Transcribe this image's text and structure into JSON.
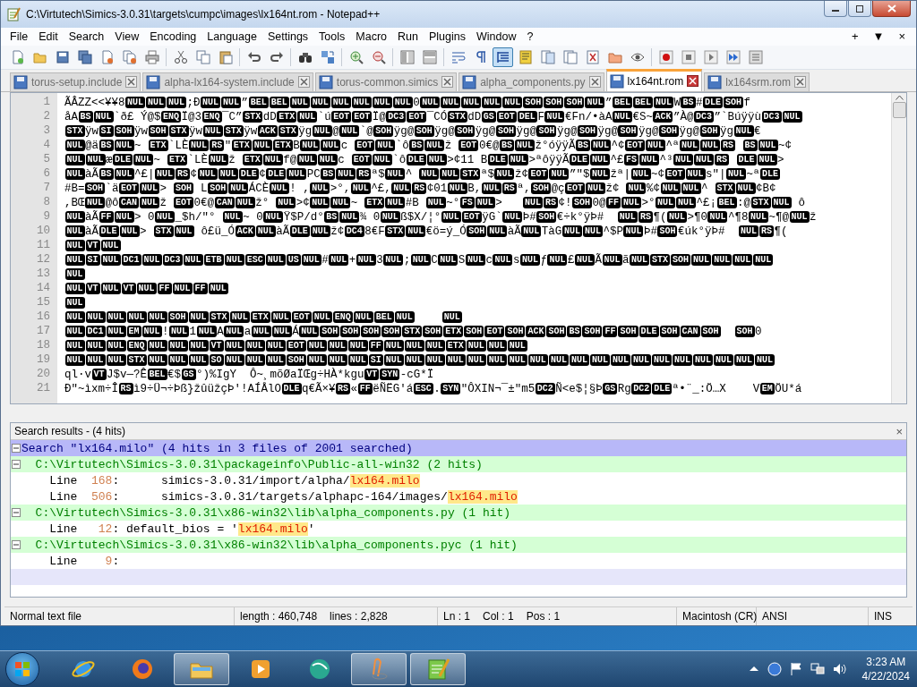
{
  "window": {
    "title": "C:\\Virtutech\\Simics-3.0.31\\targets\\cumpc\\images\\lx164nt.rom - Notepad++"
  },
  "menu": {
    "items": [
      "File",
      "Edit",
      "Search",
      "View",
      "Encoding",
      "Language",
      "Settings",
      "Tools",
      "Macro",
      "Run",
      "Plugins",
      "Window",
      "?"
    ],
    "right": [
      "+",
      "▼",
      "×"
    ]
  },
  "toolbar": [
    {
      "kind": "new",
      "pressed": false
    },
    {
      "kind": "open",
      "pressed": false
    },
    {
      "kind": "save",
      "pressed": false
    },
    {
      "kind": "save-all",
      "pressed": false
    },
    {
      "kind": "close",
      "pressed": false
    },
    {
      "kind": "close-all",
      "pressed": false
    },
    {
      "kind": "print",
      "pressed": false
    },
    {
      "kind": "sep"
    },
    {
      "kind": "cut",
      "pressed": false
    },
    {
      "kind": "copy",
      "pressed": false
    },
    {
      "kind": "paste",
      "pressed": false
    },
    {
      "kind": "sep"
    },
    {
      "kind": "undo",
      "pressed": false
    },
    {
      "kind": "redo",
      "pressed": false
    },
    {
      "kind": "sep"
    },
    {
      "kind": "find",
      "pressed": false
    },
    {
      "kind": "replace",
      "pressed": false
    },
    {
      "kind": "sep"
    },
    {
      "kind": "zoom-in",
      "pressed": false
    },
    {
      "kind": "zoom-out",
      "pressed": false
    },
    {
      "kind": "sep"
    },
    {
      "kind": "sync-v",
      "pressed": false
    },
    {
      "kind": "sync-h",
      "pressed": false
    },
    {
      "kind": "sep"
    },
    {
      "kind": "wrap",
      "pressed": false
    },
    {
      "kind": "pilcrow",
      "pressed": false
    },
    {
      "kind": "indent",
      "pressed": true
    },
    {
      "kind": "lang",
      "pressed": false
    },
    {
      "kind": "docmap",
      "pressed": false
    },
    {
      "kind": "doclist",
      "pressed": false
    },
    {
      "kind": "funclist",
      "pressed": false
    },
    {
      "kind": "folder",
      "pressed": false
    },
    {
      "kind": "eye",
      "pressed": false
    },
    {
      "kind": "sep"
    },
    {
      "kind": "record",
      "pressed": false
    },
    {
      "kind": "stop",
      "pressed": false
    },
    {
      "kind": "play",
      "pressed": false
    },
    {
      "kind": "play-multi",
      "pressed": false
    },
    {
      "kind": "save-macro",
      "pressed": false
    }
  ],
  "tabs": [
    {
      "label": "torus-setup.include",
      "selected": false
    },
    {
      "label": "alpha-lx164-system.include",
      "selected": false
    },
    {
      "label": "torus-common.simics",
      "selected": false
    },
    {
      "label": "alpha_components.py",
      "selected": false
    },
    {
      "label": "lx164nt.rom",
      "selected": true
    },
    {
      "label": "lx164srm.rom",
      "selected": false
    }
  ],
  "editor": {
    "lines": [
      {
        "number": "1",
        "segments": [
          {
            "text": "ÃÂZZ<<¥¥8"
          },
          {
            "controls": [
              "NUL",
              "NUL",
              "NUL"
            ]
          },
          {
            "text": ";Ð"
          },
          {
            "controls": [
              "NUL",
              "NUL"
            ]
          },
          {
            "text": "”"
          },
          {
            "controls": [
              "BEL",
              "BEL",
              "NUL",
              "NUL",
              "NUL",
              "NUL",
              "NUL",
              "NUL"
            ]
          },
          {
            "text": "0"
          },
          {
            "controls": [
              "NUL",
              "NUL",
              "NUL",
              "NUL",
              "NUL",
              "SOH",
              "SOH",
              "SOH",
              "NUL"
            ]
          },
          {
            "text": "”"
          },
          {
            "controls": [
              "BEL",
              "BEL",
              "NUL"
            ]
          },
          {
            "text": "W"
          },
          {
            "controls": [
              "BS"
            ]
          },
          {
            "text": "#"
          },
          {
            "controls": [
              "DLE",
              "SOH"
            ]
          },
          {
            "text": "f"
          }
        ]
      },
      {
        "number": "2",
        "segments": [
          {
            "text": "åA"
          },
          {
            "controls": [
              "BS",
              "NUL"
            ]
          },
          {
            "text": "`ð£ Ý@$"
          },
          {
            "controls": [
              "ENQ"
            ]
          },
          {
            "text": "Ï@3"
          },
          {
            "controls": [
              "ENQ"
            ]
          },
          {
            "text": "¯C”"
          },
          {
            "controls": [
              "STX"
            ]
          },
          {
            "text": "dD"
          },
          {
            "controls": [
              "ETX",
              "NUL"
            ]
          },
          {
            "text": "`ú"
          },
          {
            "controls": [
              "EOT",
              "EOT"
            ]
          },
          {
            "text": "Ï@"
          },
          {
            "controls": [
              "DC3",
              "EOT"
            ]
          },
          {
            "text": "¯CÓ"
          },
          {
            "controls": [
              "STX"
            ]
          },
          {
            "text": "dD"
          },
          {
            "controls": [
              "GS",
              "EOT",
              "DEL"
            ]
          },
          {
            "text": "F"
          },
          {
            "controls": [
              "NUL"
            ]
          },
          {
            "text": "€Fn/•àA"
          },
          {
            "controls": [
              "NUL"
            ]
          },
          {
            "text": "€S~"
          },
          {
            "controls": [
              "ACK"
            ]
          },
          {
            "text": "”À@"
          },
          {
            "controls": [
              "DC3"
            ]
          },
          {
            "text": "”`Búÿÿù"
          },
          {
            "controls": [
              "DC3",
              "NUL"
            ]
          }
        ]
      },
      {
        "number": "3",
        "segments": [
          {
            "controls": [
              "STX"
            ]
          },
          {
            "text": "ÿw"
          },
          {
            "controls": [
              "SI",
              "SOH"
            ]
          },
          {
            "text": "ÿw"
          },
          {
            "controls": [
              "SOH",
              "STX"
            ]
          },
          {
            "text": "ÿw"
          },
          {
            "controls": [
              "NUL",
              "STX"
            ]
          },
          {
            "text": "ÿw"
          },
          {
            "controls": [
              "ACK",
              "STX"
            ]
          },
          {
            "text": "ÿg"
          },
          {
            "controls": [
              "NUL"
            ]
          },
          {
            "text": "@"
          },
          {
            "controls": [
              "NUL"
            ]
          },
          {
            "text": "`@"
          },
          {
            "controls": [
              "SOH"
            ]
          },
          {
            "text": "ÿg@"
          },
          {
            "controls": [
              "SOH"
            ]
          },
          {
            "text": "ÿg@"
          },
          {
            "controls": [
              "SOH"
            ]
          },
          {
            "text": "ÿg@"
          },
          {
            "controls": [
              "SOH"
            ]
          },
          {
            "text": "ÿg@"
          },
          {
            "controls": [
              "SOH"
            ]
          },
          {
            "text": "ÿg@"
          },
          {
            "controls": [
              "SOH"
            ]
          },
          {
            "text": "ÿg@"
          },
          {
            "controls": [
              "SOH"
            ]
          },
          {
            "text": "ÿg@"
          },
          {
            "controls": [
              "SOH"
            ]
          },
          {
            "text": "ÿg@"
          },
          {
            "controls": [
              "SOH"
            ]
          },
          {
            "text": "ÿg"
          },
          {
            "controls": [
              "NUL"
            ]
          },
          {
            "text": "€"
          }
        ]
      },
      {
        "number": "4",
        "segments": [
          {
            "controls": [
              "NUL"
            ]
          },
          {
            "text": "@ä"
          },
          {
            "controls": [
              "BS",
              "NUL"
            ]
          },
          {
            "text": "~ "
          },
          {
            "controls": [
              "ETX"
            ]
          },
          {
            "text": "`LÈ"
          },
          {
            "controls": [
              "NUL",
              "RS"
            ]
          },
          {
            "text": "\""
          },
          {
            "controls": [
              "ETX",
              "NUL",
              "ETX"
            ]
          },
          {
            "text": "B"
          },
          {
            "controls": [
              "NUL",
              "NUL"
            ]
          },
          {
            "text": "c "
          },
          {
            "controls": [
              "EOT",
              "NUL"
            ]
          },
          {
            "text": "`ô"
          },
          {
            "controls": [
              "BS",
              "NUL"
            ]
          },
          {
            "text": "ž "
          },
          {
            "controls": [
              "EOT"
            ]
          },
          {
            "text": "0€@"
          },
          {
            "controls": [
              "BS",
              "NUL"
            ]
          },
          {
            "text": "ž°óÿÿÃ"
          },
          {
            "controls": [
              "BS",
              "NUL"
            ]
          },
          {
            "text": "^¢"
          },
          {
            "controls": [
              "EOT",
              "NUL"
            ]
          },
          {
            "text": "^ª"
          },
          {
            "controls": [
              "NUL",
              "NUL",
              "RS"
            ]
          },
          {
            "space": true
          },
          {
            "controls": [
              "BS",
              "NUL"
            ]
          },
          {
            "text": "~¢"
          }
        ]
      },
      {
        "number": "5",
        "segments": [
          {
            "controls": [
              "NUL",
              "NUL"
            ]
          },
          {
            "text": "æ"
          },
          {
            "controls": [
              "DLE",
              "NUL"
            ]
          },
          {
            "text": "~ "
          },
          {
            "controls": [
              "ETX"
            ]
          },
          {
            "text": "`LÈ"
          },
          {
            "controls": [
              "NUL"
            ]
          },
          {
            "text": "ž "
          },
          {
            "controls": [
              "ETX",
              "NUL"
            ]
          },
          {
            "text": "f@"
          },
          {
            "controls": [
              "NUL",
              "NUL"
            ]
          },
          {
            "text": "c "
          },
          {
            "controls": [
              "EOT",
              "NUL"
            ]
          },
          {
            "text": "`ô"
          },
          {
            "controls": [
              "DLE",
              "NUL"
            ]
          },
          {
            "text": ">¢11 B"
          },
          {
            "controls": [
              "DLE",
              "NUL"
            ]
          },
          {
            "text": ">ªôÿÿÃ"
          },
          {
            "controls": [
              "DLE",
              "NUL"
            ]
          },
          {
            "text": "^£"
          },
          {
            "controls": [
              "FS",
              "NUL"
            ]
          },
          {
            "text": "^³"
          },
          {
            "controls": [
              "NUL",
              "NUL",
              "RS"
            ]
          },
          {
            "space": true
          },
          {
            "controls": [
              "DLE",
              "NUL"
            ]
          },
          {
            "text": ">"
          }
        ]
      },
      {
        "number": "6",
        "segments": [
          {
            "controls": [
              "NUL"
            ]
          },
          {
            "text": "àÃ"
          },
          {
            "controls": [
              "BS",
              "NUL"
            ]
          },
          {
            "text": "^£|"
          },
          {
            "controls": [
              "NUL",
              "RS"
            ]
          },
          {
            "text": "¢"
          },
          {
            "controls": [
              "NUL",
              "NUL",
              "DLE"
            ]
          },
          {
            "text": "¢"
          },
          {
            "controls": [
              "DLE",
              "NUL"
            ]
          },
          {
            "text": "PC"
          },
          {
            "controls": [
              "BS",
              "NUL",
              "RS"
            ]
          },
          {
            "text": "ª$"
          },
          {
            "controls": [
              "NUL"
            ]
          },
          {
            "text": "^ "
          },
          {
            "controls": [
              "NUL",
              "NUL",
              "STX"
            ]
          },
          {
            "text": "ª$"
          },
          {
            "controls": [
              "NUL"
            ]
          },
          {
            "text": "ž¢"
          },
          {
            "controls": [
              "EOT",
              "NUL"
            ]
          },
          {
            "text": "”\"$"
          },
          {
            "controls": [
              "NUL"
            ]
          },
          {
            "text": "žª|"
          },
          {
            "controls": [
              "NUL"
            ]
          },
          {
            "text": "~¢"
          },
          {
            "controls": [
              "EOT",
              "NUL"
            ]
          },
          {
            "text": "s\"|"
          },
          {
            "controls": [
              "NUL"
            ]
          },
          {
            "text": "~ª"
          },
          {
            "controls": [
              "DLE"
            ]
          }
        ]
      },
      {
        "number": "7",
        "segments": [
          {
            "text": "#B="
          },
          {
            "controls": [
              "SOH"
            ]
          },
          {
            "text": "`ä"
          },
          {
            "controls": [
              "EOT",
              "NUL"
            ]
          },
          {
            "text": "> "
          },
          {
            "controls": [
              "SOH"
            ]
          },
          {
            "text": " L"
          },
          {
            "controls": [
              "SOH",
              "NUL"
            ]
          },
          {
            "text": "ÁCÈ"
          },
          {
            "controls": [
              "NUL"
            ]
          },
          {
            "text": "! ,"
          },
          {
            "controls": [
              "NUL"
            ]
          },
          {
            "text": ">°,"
          },
          {
            "controls": [
              "NUL"
            ]
          },
          {
            "text": "^£,"
          },
          {
            "controls": [
              "NUL",
              "RS"
            ]
          },
          {
            "text": "¢01"
          },
          {
            "controls": [
              "NUL"
            ]
          },
          {
            "text": "B,"
          },
          {
            "controls": [
              "NUL",
              "RS"
            ]
          },
          {
            "text": "ª,"
          },
          {
            "controls": [
              "SOH"
            ]
          },
          {
            "text": "@ç"
          },
          {
            "controls": [
              "EOT",
              "NUL"
            ]
          },
          {
            "text": "ž¢ "
          },
          {
            "controls": [
              "NUL"
            ]
          },
          {
            "text": "%¢"
          },
          {
            "controls": [
              "NUL",
              "NUL"
            ]
          },
          {
            "text": "^ "
          },
          {
            "controls": [
              "STX",
              "NUL"
            ]
          },
          {
            "text": "¢B¢"
          }
        ]
      },
      {
        "number": "8",
        "segments": [
          {
            "text": ",BŒ"
          },
          {
            "controls": [
              "NUL"
            ]
          },
          {
            "text": "@ô"
          },
          {
            "controls": [
              "CAN",
              "NUL"
            ]
          },
          {
            "text": "ž "
          },
          {
            "controls": [
              "EOT"
            ]
          },
          {
            "text": "0€@"
          },
          {
            "controls": [
              "CAN",
              "NUL"
            ]
          },
          {
            "text": "ž° "
          },
          {
            "controls": [
              "NUL"
            ]
          },
          {
            "text": ">¢"
          },
          {
            "controls": [
              "NUL",
              "NUL"
            ]
          },
          {
            "text": "~ "
          },
          {
            "controls": [
              "ETX",
              "NUL"
            ]
          },
          {
            "text": "#B "
          },
          {
            "controls": [
              "NUL"
            ]
          },
          {
            "text": "~°"
          },
          {
            "controls": [
              "FS",
              "NUL"
            ]
          },
          {
            "text": ">   "
          },
          {
            "controls": [
              "NUL",
              "RS"
            ]
          },
          {
            "text": "¢!"
          },
          {
            "controls": [
              "SOH"
            ]
          },
          {
            "text": "0@"
          },
          {
            "controls": [
              "FF",
              "NUL"
            ]
          },
          {
            "text": ">°"
          },
          {
            "controls": [
              "NUL",
              "NUL"
            ]
          },
          {
            "text": "^£¡"
          },
          {
            "controls": [
              "BEL"
            ]
          },
          {
            "text": ":@"
          },
          {
            "controls": [
              "STX",
              "NUL"
            ]
          },
          {
            "text": " ô"
          }
        ]
      },
      {
        "number": "9",
        "segments": [
          {
            "controls": [
              "NUL"
            ]
          },
          {
            "text": "àÃ"
          },
          {
            "controls": [
              "FF",
              "NUL"
            ]
          },
          {
            "text": "> 0"
          },
          {
            "controls": [
              "NUL"
            ]
          },
          {
            "text": "_$h/\"° "
          },
          {
            "controls": [
              "NUL"
            ]
          },
          {
            "text": "~ 0"
          },
          {
            "controls": [
              "NUL"
            ]
          },
          {
            "text": "Ÿ$P/d°"
          },
          {
            "controls": [
              "BS",
              "NUL"
            ]
          },
          {
            "text": "¾ 0"
          },
          {
            "controls": [
              "NUL"
            ]
          },
          {
            "text": "ß$X/¦°"
          },
          {
            "controls": [
              "NUL",
              "EOT"
            ]
          },
          {
            "text": "ÿG`"
          },
          {
            "controls": [
              "NUL"
            ]
          },
          {
            "text": "Þ#"
          },
          {
            "controls": [
              "SOH"
            ]
          },
          {
            "text": "€÷k°ÿÞ#  "
          },
          {
            "controls": [
              "NUL",
              "RS"
            ]
          },
          {
            "text": "¶("
          },
          {
            "controls": [
              "NUL"
            ]
          },
          {
            "text": ">¶0"
          },
          {
            "controls": [
              "NUL"
            ]
          },
          {
            "text": "^¶8"
          },
          {
            "controls": [
              "NUL"
            ]
          },
          {
            "text": "~¶@"
          },
          {
            "controls": [
              "NUL"
            ]
          },
          {
            "text": "ž"
          }
        ]
      },
      {
        "number": "10",
        "segments": [
          {
            "controls": [
              "NUL"
            ]
          },
          {
            "text": "àÃ"
          },
          {
            "controls": [
              "DLE",
              "NUL"
            ]
          },
          {
            "text": "> "
          },
          {
            "controls": [
              "STX",
              "NUL"
            ]
          },
          {
            "text": " ô£ü_Ó"
          },
          {
            "controls": [
              "ACK",
              "NUL"
            ]
          },
          {
            "text": "àÃ"
          },
          {
            "controls": [
              "DLE",
              "NUL"
            ]
          },
          {
            "text": "ž¢"
          },
          {
            "controls": [
              "DC4"
            ]
          },
          {
            "text": "8€F"
          },
          {
            "controls": [
              "STX",
              "NUL"
            ]
          },
          {
            "text": "€ö=ý_Ó"
          },
          {
            "controls": [
              "SOH",
              "NUL"
            ]
          },
          {
            "text": "àÃ"
          },
          {
            "controls": [
              "NUL"
            ]
          },
          {
            "text": "TàG"
          },
          {
            "controls": [
              "NUL",
              "NUL"
            ]
          },
          {
            "text": "^$P"
          },
          {
            "controls": [
              "NUL"
            ]
          },
          {
            "text": "Þ#"
          },
          {
            "controls": [
              "SOH"
            ]
          },
          {
            "text": "€úk°ÿÞ#  "
          },
          {
            "controls": [
              "NUL",
              "RS"
            ]
          },
          {
            "text": "¶("
          }
        ]
      },
      {
        "number": "11",
        "segments": [
          {
            "controls": [
              "NUL",
              "VT",
              "NUL"
            ]
          }
        ]
      },
      {
        "number": "12",
        "segments": [
          {
            "controls": [
              "NUL",
              "SI",
              "NUL",
              "DC1",
              "NUL",
              "DC3",
              "NUL",
              "ETB",
              "NUL",
              "ESC",
              "NUL",
              "US",
              "NUL"
            ]
          },
          {
            "text": "#"
          },
          {
            "controls": [
              "NUL"
            ]
          },
          {
            "text": "+"
          },
          {
            "controls": [
              "NUL"
            ]
          },
          {
            "text": "3"
          },
          {
            "controls": [
              "NUL"
            ]
          },
          {
            "text": ";"
          },
          {
            "controls": [
              "NUL"
            ]
          },
          {
            "text": "C"
          },
          {
            "controls": [
              "NUL"
            ]
          },
          {
            "text": "S"
          },
          {
            "controls": [
              "NUL"
            ]
          },
          {
            "text": "c"
          },
          {
            "controls": [
              "NUL"
            ]
          },
          {
            "text": "s"
          },
          {
            "controls": [
              "NUL"
            ]
          },
          {
            "text": "ƒ"
          },
          {
            "controls": [
              "NUL"
            ]
          },
          {
            "text": "£"
          },
          {
            "controls": [
              "NUL"
            ]
          },
          {
            "text": "Ã"
          },
          {
            "controls": [
              "NUL"
            ]
          },
          {
            "text": "ã"
          },
          {
            "controls": [
              "NUL",
              "STX",
              "SOH",
              "NUL",
              "NUL",
              "NUL",
              "NUL"
            ]
          }
        ]
      },
      {
        "number": "13",
        "segments": [
          {
            "controls": [
              "NUL"
            ]
          }
        ]
      },
      {
        "number": "14",
        "segments": [
          {
            "controls": [
              "NUL",
              "VT",
              "NUL",
              "VT",
              "NUL",
              "FF",
              "NUL",
              "FF",
              "NUL"
            ]
          }
        ]
      },
      {
        "number": "15",
        "segments": [
          {
            "controls": [
              "NUL"
            ]
          }
        ]
      },
      {
        "number": "16",
        "segments": [
          {
            "controls": [
              "NUL",
              "NUL",
              "NUL",
              "NUL",
              "NUL",
              "SOH",
              "NUL",
              "STX",
              "NUL",
              "ETX",
              "NUL",
              "EOT",
              "NUL",
              "ENQ",
              "NUL",
              "BEL",
              "NUL"
            ]
          },
          {
            "space": true
          },
          {
            "space": true
          },
          {
            "space": true
          },
          {
            "space": true
          },
          {
            "controls": [
              "NUL"
            ]
          }
        ]
      },
      {
        "number": "17",
        "segments": [
          {
            "controls": [
              "NUL",
              "DC1",
              "NUL",
              "EM",
              "NUL"
            ]
          },
          {
            "text": "!"
          },
          {
            "controls": [
              "NUL"
            ]
          },
          {
            "text": "1"
          },
          {
            "controls": [
              "NUL"
            ]
          },
          {
            "text": "A"
          },
          {
            "controls": [
              "NUL"
            ]
          },
          {
            "text": "a"
          },
          {
            "controls": [
              "NUL",
              "NUL"
            ]
          },
          {
            "text": "Á"
          },
          {
            "controls": [
              "NUL",
              "SOH",
              "SOH",
              "SOH",
              "SOH",
              "STX",
              "SOH",
              "ETX",
              "SOH",
              "EOT",
              "SOH",
              "ACK",
              "SOH",
              "BS",
              "SOH",
              "FF",
              "SOH",
              "DLE",
              "SOH",
              "CAN",
              "SOH"
            ]
          },
          {
            "space": true
          },
          {
            "space": true
          },
          {
            "controls": [
              "SOH"
            ]
          },
          {
            "text": "0"
          }
        ]
      },
      {
        "number": "18",
        "segments": [
          {
            "controls": [
              "NUL",
              "NUL",
              "NUL",
              "ENQ",
              "NUL",
              "NUL",
              "NUL",
              "VT",
              "NUL",
              "NUL",
              "NUL",
              "EOT",
              "NUL",
              "NUL",
              "NUL",
              "FF",
              "NUL",
              "NUL",
              "NUL",
              "ETX",
              "NUL",
              "NUL",
              "NUL"
            ]
          }
        ]
      },
      {
        "number": "19",
        "segments": [
          {
            "controls": [
              "NUL",
              "NUL",
              "NUL",
              "STX",
              "NUL",
              "NUL",
              "NUL",
              "SO",
              "NUL",
              "NUL",
              "NUL",
              "SOH",
              "NUL",
              "NUL",
              "NUL",
              "SI",
              "NUL",
              "NUL",
              "NUL",
              "NUL",
              "NUL",
              "NUL",
              "NUL",
              "NUL",
              "NUL",
              "NUL",
              "NUL",
              "NUL",
              "NUL",
              "NUL",
              "NUL",
              "NUL",
              "NUL",
              "NUL",
              "NUL"
            ]
          }
        ]
      },
      {
        "number": "20",
        "segments": [
          {
            "text": "ql·v"
          },
          {
            "controls": [
              "VT"
            ]
          },
          {
            "text": "J$v—?Ê"
          },
          {
            "controls": [
              "BEL"
            ]
          },
          {
            "text": "€$"
          },
          {
            "controls": [
              "GS"
            ]
          },
          {
            "text": "°)%IgY  Ô~¸mõØaÏŒg÷HÀ*kgu"
          },
          {
            "controls": [
              "VT",
              "SYN"
            ]
          },
          {
            "text": "-cG*Ï"
          }
        ]
      },
      {
        "number": "21",
        "segments": [
          {
            "text": "Ð\"~ìxm÷Î"
          },
          {
            "controls": [
              "RS"
            ]
          },
          {
            "text": "ì9÷Ü¬÷Þß}žûüžçÞ'!AÍÅlO"
          },
          {
            "controls": [
              "DLE"
            ]
          },
          {
            "text": "q€Ã×¥"
          },
          {
            "controls": [
              "RS"
            ]
          },
          {
            "text": "«"
          },
          {
            "controls": [
              "FF"
            ]
          },
          {
            "text": "ëÑËG'á"
          },
          {
            "controls": [
              "ESC"
            ]
          },
          {
            "text": "."
          },
          {
            "controls": [
              "SYN"
            ]
          },
          {
            "text": "\"ÔXIN¬¯±\"m5"
          },
          {
            "controls": [
              "DC2"
            ]
          },
          {
            "text": "Ñ<e$¦§Þ"
          },
          {
            "controls": [
              "GS"
            ]
          },
          {
            "text": "Rg"
          },
          {
            "controls": [
              "DC2",
              "DLE"
            ]
          },
          {
            "text": "ª•¨_:Ö…X    V"
          },
          {
            "controls": [
              "EM"
            ]
          },
          {
            "text": "ÖU*á"
          }
        ]
      }
    ]
  },
  "search_results": {
    "title": "Search results - (4 hits)",
    "close": "×",
    "summary": "Search \"lx164.milo\" (4 hits in 3 files of 2001 searched)",
    "files": [
      {
        "path": "C:\\Virtutech\\Simics-3.0.31\\packageinfo\\Public-all-win32 (2 hits)",
        "hits": [
          {
            "label": "Line",
            "number": "168",
            "text": ":      simics-3.0.31/import/alpha/",
            "match": "lx164.milo"
          },
          {
            "label": "Line",
            "number": "506",
            "text": ":      simics-3.0.31/targets/alphapc-164/images/",
            "match": "lx164.milo"
          }
        ]
      },
      {
        "path": "C:\\Virtutech\\Simics-3.0.31\\x86-win32\\lib\\alpha_components.py (1 hit)",
        "hits": [
          {
            "label": "Line",
            "number": "12",
            "text": ": default_bios = '",
            "match": "lx164.milo",
            "after": "'"
          }
        ]
      },
      {
        "path": "C:\\Virtutech\\Simics-3.0.31\\x86-win32\\lib\\alpha_components.pyc (1 hit)",
        "hits": [
          {
            "label": "Line",
            "number": "9",
            "text": ":"
          }
        ]
      }
    ]
  },
  "status_bar": {
    "file_type": "Normal text file",
    "length": "length : 460,748",
    "lines": "lines : 2,828",
    "ln": "Ln : 1",
    "col": "Col : 1",
    "pos": "Pos : 1",
    "eol": "Macintosh (CR)",
    "encoding": "ANSI",
    "mode": "INS"
  },
  "taskbar": {
    "apps": [
      {
        "kind": "ie",
        "active": false
      },
      {
        "kind": "firefox",
        "active": false
      },
      {
        "kind": "explorer",
        "active": true
      },
      {
        "kind": "media",
        "active": false
      },
      {
        "kind": "sphere",
        "active": false
      },
      {
        "kind": "figure",
        "active": true
      },
      {
        "kind": "notepad",
        "active": true
      }
    ],
    "time": "3:23 AM",
    "date": "4/22/2024"
  }
}
